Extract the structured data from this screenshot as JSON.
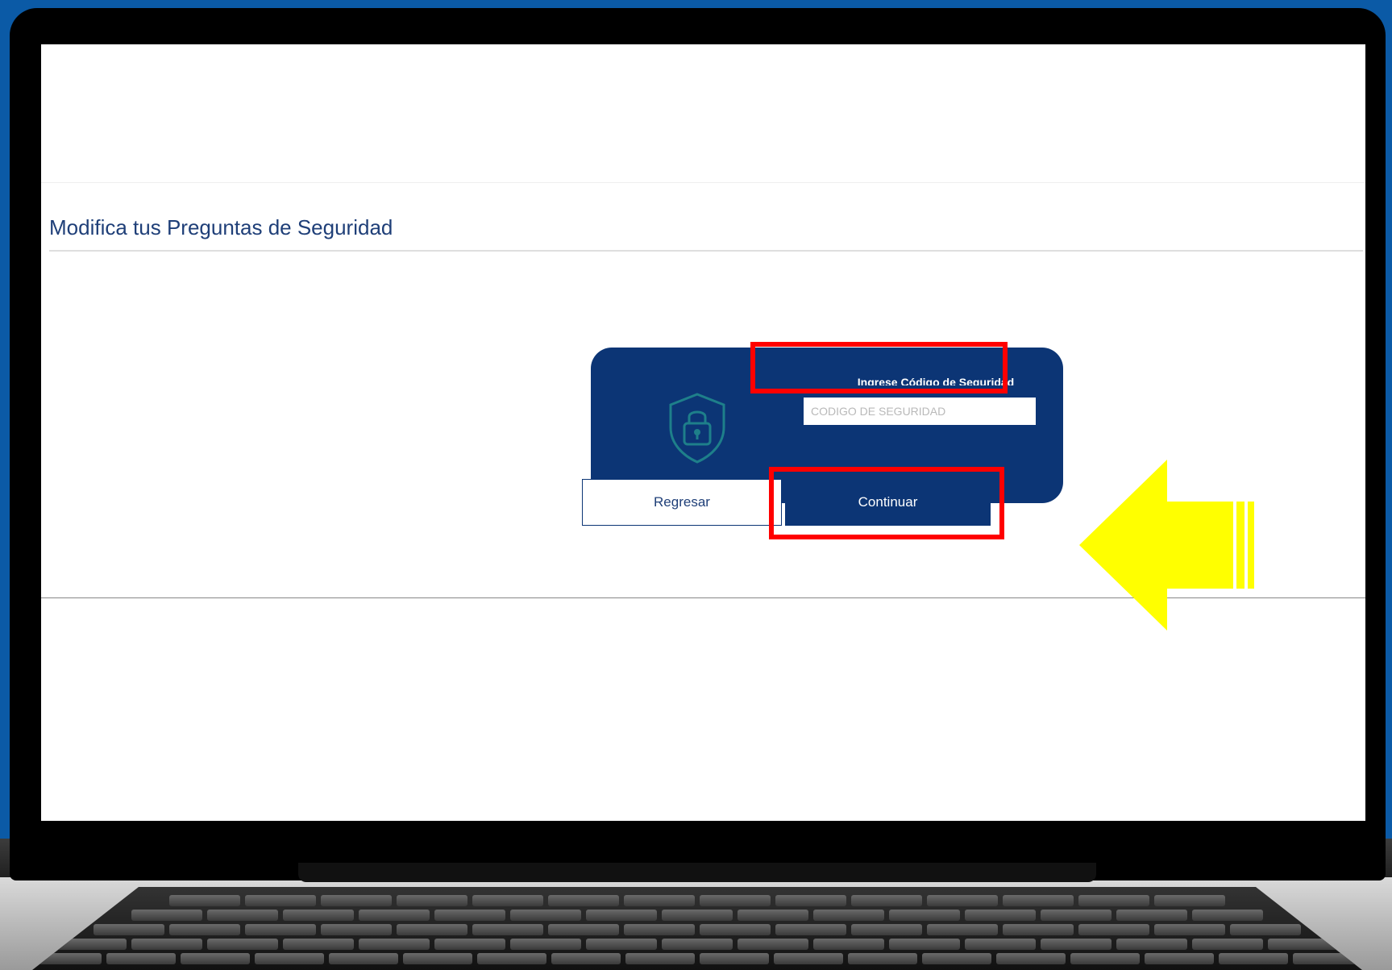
{
  "page": {
    "title": "Modifica tus Preguntas de Seguridad"
  },
  "security_card": {
    "label": "Ingrese Código de Seguridad",
    "input_placeholder": "CODIGO DE SEGURIDAD",
    "input_value": "",
    "icon": "shield-lock-icon"
  },
  "actions": {
    "back_label": "Regresar",
    "continue_label": "Continuar"
  },
  "annotations": {
    "highlight_color": "#ff0000",
    "arrow_color": "#ffff00",
    "arrow_icon": "arrow-left-icon"
  },
  "colors": {
    "primary": "#0c3575",
    "title_text": "#1f3f78",
    "background": "#0b5aa6"
  }
}
